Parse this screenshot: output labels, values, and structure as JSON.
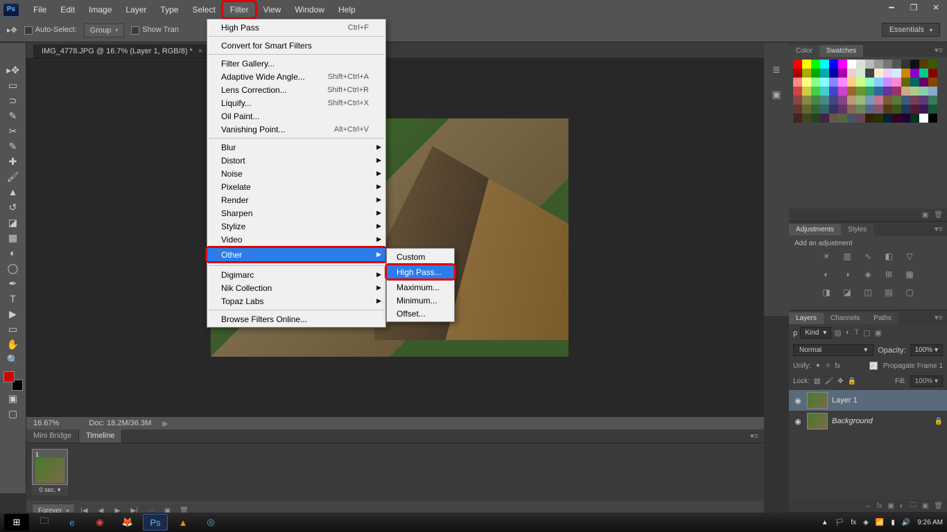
{
  "app": {
    "logo": "Ps"
  },
  "menubar": [
    "File",
    "Edit",
    "Image",
    "Layer",
    "Type",
    "Select",
    "Filter",
    "View",
    "Window",
    "Help"
  ],
  "options": {
    "auto_select": "Auto-Select:",
    "group": "Group",
    "show_trans": "Show Tran",
    "workspace": "Essentials"
  },
  "document": {
    "tab": "IMG_4778.JPG @ 16.7% (Layer 1, RGB/8) *",
    "zoom": "16.67%",
    "docinfo": "Doc: 18.2M/36.3M"
  },
  "filter_menu": {
    "last_filter": "High Pass",
    "last_shortcut": "Ctrl+F",
    "smart": "Convert for Smart Filters",
    "gallery": "Filter Gallery...",
    "adaptive": "Adaptive Wide Angle...",
    "adaptive_sc": "Shift+Ctrl+A",
    "lens": "Lens Correction...",
    "lens_sc": "Shift+Ctrl+R",
    "liquify": "Liquify...",
    "liquify_sc": "Shift+Ctrl+X",
    "oil": "Oil Paint...",
    "vanish": "Vanishing Point...",
    "vanish_sc": "Alt+Ctrl+V",
    "groups": [
      "Blur",
      "Distort",
      "Noise",
      "Pixelate",
      "Render",
      "Sharpen",
      "Stylize",
      "Video",
      "Other"
    ],
    "plugins": [
      "Digimarc",
      "Nik Collection",
      "Topaz Labs"
    ],
    "browse": "Browse Filters Online..."
  },
  "other_submenu": [
    "Custom",
    "High Pass...",
    "Maximum...",
    "Minimum...",
    "Offset..."
  ],
  "panels": {
    "color_tabs": [
      "Color",
      "Swatches"
    ],
    "adjust_tabs": [
      "Adjustments",
      "Styles"
    ],
    "adjust_title": "Add an adjustment",
    "layer_tabs": [
      "Layers",
      "Channels",
      "Paths"
    ],
    "kind": "Kind",
    "blend": "Normal",
    "opacity_label": "Opacity:",
    "opacity_val": "100%",
    "unify": "Unify:",
    "propagate": "Propagate Frame 1",
    "lock": "Lock:",
    "fill_label": "Fill:",
    "fill_val": "100%",
    "layer1": "Layer 1",
    "background": "Background"
  },
  "timeline": {
    "tabs": [
      "Mini Bridge",
      "Timeline"
    ],
    "frame_delay": "0 sec.",
    "loop": "Forever"
  },
  "tray": {
    "time": "9:26 AM"
  },
  "swatch_colors": [
    "#ff0000",
    "#ffff00",
    "#00ff00",
    "#00ffff",
    "#0000ff",
    "#ff00ff",
    "#ffffff",
    "#dddddd",
    "#bbbbbb",
    "#999999",
    "#777777",
    "#555555",
    "#333333",
    "#111111",
    "#5a3a00",
    "#3a5a00",
    "#aa0000",
    "#aaaa00",
    "#00aa00",
    "#00aaaa",
    "#0000aa",
    "#aa00aa",
    "#eecccc",
    "#cceecc",
    "#cccceee",
    "#ffeecc",
    "#eeccff",
    "#cceeff",
    "#cc8800",
    "#8800cc",
    "#00cc88",
    "#880000",
    "#ff8888",
    "#ffff88",
    "#88ff88",
    "#88ffff",
    "#8888ff",
    "#ff88ff",
    "#ffcc88",
    "#ccff88",
    "#88ffcc",
    "#88ccff",
    "#cc88ff",
    "#ff88cc",
    "#666600",
    "#006666",
    "#660066",
    "#884400",
    "#cc4444",
    "#cccc44",
    "#44cc44",
    "#44cccc",
    "#4444cc",
    "#cc44cc",
    "#996633",
    "#669933",
    "#339966",
    "#336699",
    "#663399",
    "#993366",
    "#ccaa88",
    "#aacc88",
    "#88ccaa",
    "#88aacc",
    "#884444",
    "#888844",
    "#448844",
    "#448888",
    "#444488",
    "#884488",
    "#bb9977",
    "#99bb77",
    "#7799bb",
    "#bb7799",
    "#7a5a3a",
    "#5a7a3a",
    "#3a5a7a",
    "#7a3a5a",
    "#5a3a7a",
    "#3a7a5a",
    "#663333",
    "#666633",
    "#336633",
    "#336666",
    "#333366",
    "#663366",
    "#886655",
    "#668855",
    "#556688",
    "#885566",
    "#553a1a",
    "#3a551a",
    "#1a3a55",
    "#551a3a",
    "#3a1a55",
    "#1a553a",
    "#442222",
    "#444422",
    "#224422",
    "#442244",
    "#665544",
    "#556644",
    "#445566",
    "#664455",
    "#332200",
    "#223300",
    "#002233",
    "#330022",
    "#220033",
    "#003322",
    "#ffffff",
    "#000000"
  ]
}
